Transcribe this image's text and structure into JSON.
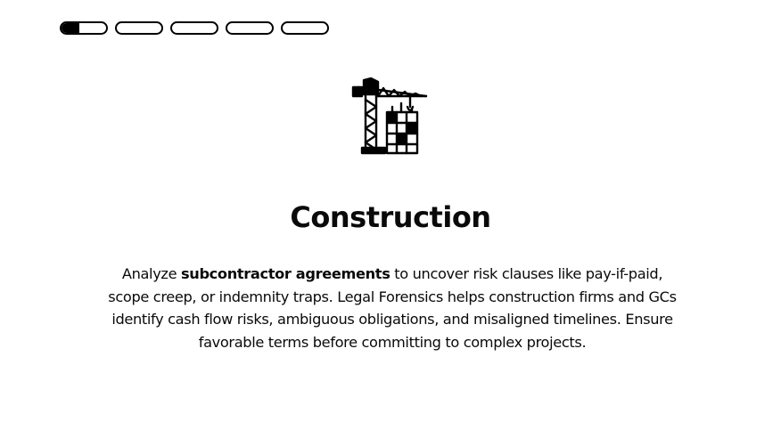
{
  "progress": {
    "steps": [
      {
        "fill": 0.4
      },
      {
        "fill": 0
      },
      {
        "fill": 0
      },
      {
        "fill": 0
      },
      {
        "fill": 0
      }
    ]
  },
  "slide": {
    "icon": "construction-crane-icon",
    "title": "Construction",
    "description_before": "Analyze ",
    "description_bold": "subcontractor agreements",
    "description_after": " to uncover risk clauses like pay-if-paid, scope creep, or indemnity traps. Legal Forensics helps construction firms and GCs identify cash flow risks, ambiguous obligations, and misaligned timelines. Ensure favorable terms before committing to complex projects."
  }
}
